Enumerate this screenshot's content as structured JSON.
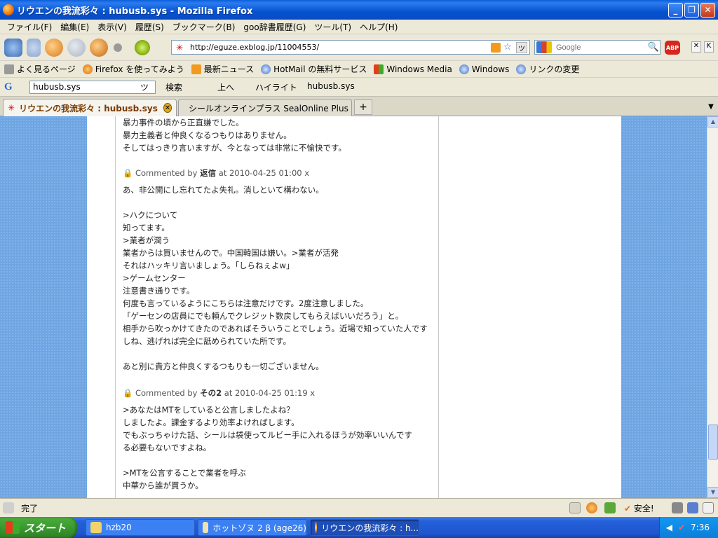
{
  "window": {
    "title": "リウエンの我流彩々 : hubusb.sys - Mozilla Firefox"
  },
  "menu": [
    "ファイル(F)",
    "編集(E)",
    "表示(V)",
    "履歴(S)",
    "ブックマーク(B)",
    "goo辞書履歴(G)",
    "ツール(T)",
    "ヘルプ(H)"
  ],
  "navigation": {
    "url": "http://eguze.exblog.jp/11004553/",
    "search_placeholder": "Google",
    "abp_label": "ABP"
  },
  "bookmarks": [
    "よく見るページ",
    "Firefox を使ってみよう",
    "最新ニュース",
    "HotMail の無料サービス",
    "Windows Media",
    "Windows",
    "リンクの変更"
  ],
  "google_toolbar": {
    "query": "hubusb.sys",
    "search_label": "検索",
    "up_label": "上へ",
    "highlight_label": "ハイライト",
    "term": "hubusb.sys"
  },
  "tabs": [
    {
      "label": "リウエンの我流彩々 : hubusb.sys",
      "active": true
    },
    {
      "label": "シールオンラインプラス SealOnline Plus",
      "active": false
    }
  ],
  "content": {
    "lines": [
      "暴力事件の頃から正直嫌でした。",
      "暴力主義者と仲良くなるつもりはありません。",
      "そしてはっきり言いますが、今となっては非常に不愉快です。",
      "",
      "",
      "あ、非公開にし忘れてたよ失礼。消しといて構わない。",
      "",
      ">ハクについて",
      "知ってます。",
      ">業者が潤う",
      "業者からは買いませんので。中国韓国は嫌い。>業者が活発",
      "それはハッキリ言いましょう。「しらねぇよw」",
      ">ゲームセンター",
      "注意書き通りです。",
      "何度も言っているようにこちらは注意だけです。2度注意しました。",
      "「ゲーセンの店員にでも頼んでクレジット数戻してもらえばいいだろう」と。",
      "相手から吹っかけてきたのであればそういうことでしょう。近場で知っていた人です",
      "しね、逃げれば完全に舐められていた所です。",
      "",
      "あと別に貴方と仲良くするつもりも一切ございません。",
      "",
      "",
      ">あなたはMTをしていると公言しましたよね？",
      "しましたよ。課金するより効率よければします。",
      "でもぶっちゃけた話、シールは袋使ってルビー手に入れるほうが効率いいんです",
      "る必要もないですよね。",
      "",
      ">MTを公言することで業者を呼ぶ",
      "中華から誰が買うか。"
    ],
    "comments": [
      {
        "prefix": "Commented by",
        "author": "返信",
        "time": "at 2010-04-25 01:00",
        "close": "x"
      },
      {
        "prefix": "Commented by",
        "author": "その2",
        "time": "at 2010-04-25 01:19",
        "close": "x"
      }
    ]
  },
  "status": {
    "text": "完了",
    "secure_label": "安全!"
  },
  "taskbar": {
    "start_label": "スタート",
    "tasks": [
      "hzb20",
      "ホットゾヌ 2 β (age26)",
      "リウエンの我流彩々 : h..."
    ],
    "clock": "7:36"
  }
}
